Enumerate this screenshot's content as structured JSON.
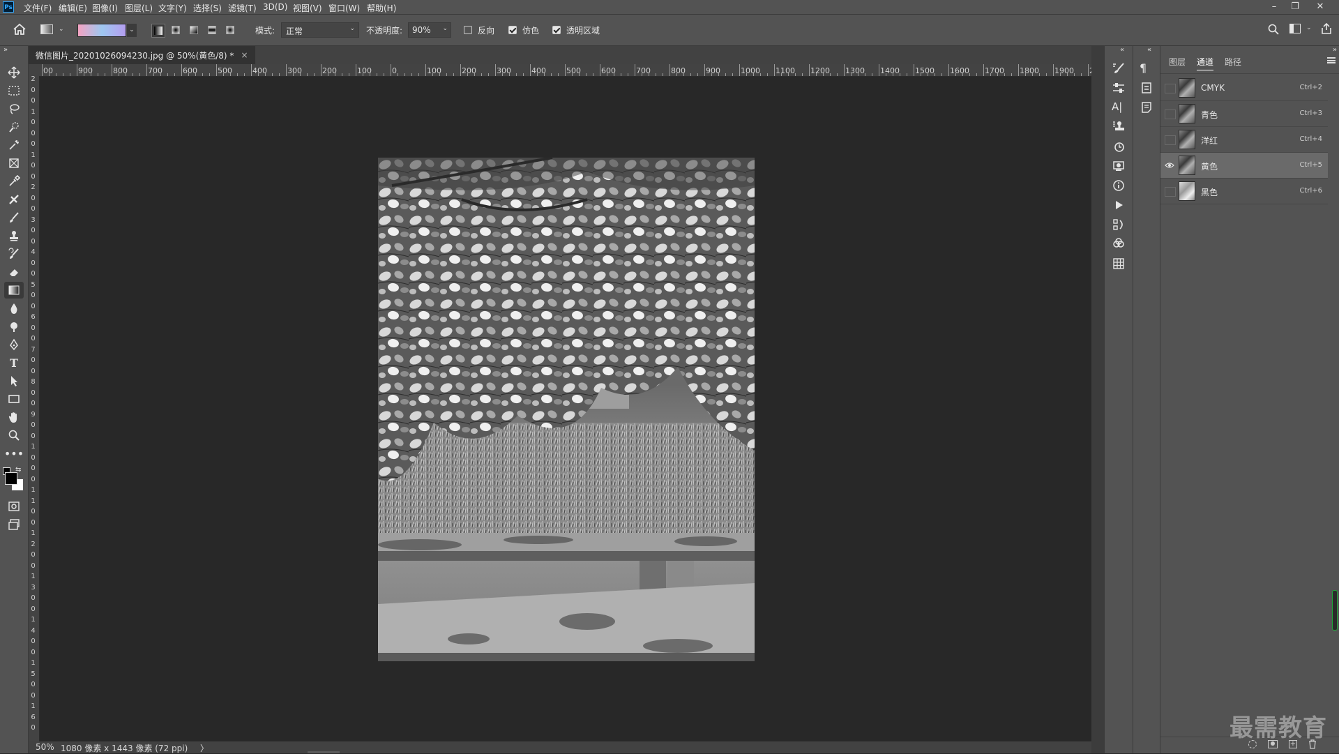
{
  "app": "Ps",
  "menu": [
    "文件(F)",
    "编辑(E)",
    "图像(I)",
    "图层(L)",
    "文字(Y)",
    "选择(S)",
    "滤镜(T)",
    "3D(D)",
    "视图(V)",
    "窗口(W)",
    "帮助(H)"
  ],
  "window_controls": [
    "minimize",
    "restore",
    "close"
  ],
  "options": {
    "mode_label": "模式:",
    "mode_value": "正常",
    "opacity_label": "不透明度:",
    "opacity_value": "90%",
    "reverse_label": "反向",
    "dither_label": "仿色",
    "transparency_label": "透明区域",
    "reverse_checked": false,
    "dither_checked": true,
    "transparency_checked": true
  },
  "document": {
    "tab_title": "微信图片_20201026094230.jpg @ 50%(黄色/8) *",
    "close": "×"
  },
  "ruler_h": [
    "00",
    "900",
    "800",
    "700",
    "600",
    "500",
    "400",
    "300",
    "200",
    "100",
    "0",
    "100",
    "200",
    "300",
    "400",
    "500",
    "600",
    "700",
    "800",
    "900",
    "1000",
    "1100",
    "1200",
    "1300",
    "1400",
    "1500",
    "1600",
    "1700",
    "1800",
    "1900",
    "200"
  ],
  "ruler_v": [
    "2",
    "0",
    "0",
    "1",
    "0",
    "0",
    "0",
    "1",
    "0",
    "0",
    "2",
    "0",
    "0",
    "3",
    "0",
    "0",
    "4",
    "0",
    "0",
    "5",
    "0",
    "0",
    "6",
    "0",
    "0",
    "7",
    "0",
    "0",
    "8",
    "0",
    "0",
    "9",
    "0",
    "0",
    "1",
    "0",
    "0",
    "0",
    "1",
    "1",
    "0",
    "0",
    "1",
    "2",
    "0",
    "0",
    "1",
    "3",
    "0",
    "0",
    "1",
    "4",
    "0",
    "0",
    "1",
    "5",
    "0",
    "0",
    "1",
    "6",
    "0"
  ],
  "status": {
    "zoom": "50%",
    "info": "1080 像素 x 1443 像素 (72 ppi)",
    "arrow": "〉"
  },
  "panel": {
    "tabs": [
      "图层",
      "通道",
      "路径"
    ],
    "active_tab": "通道",
    "channels": [
      {
        "name": "CMYK",
        "shortcut": "Ctrl+2",
        "visible": false,
        "selected": false
      },
      {
        "name": "青色",
        "shortcut": "Ctrl+3",
        "visible": false,
        "selected": false
      },
      {
        "name": "洋红",
        "shortcut": "Ctrl+4",
        "visible": false,
        "selected": false
      },
      {
        "name": "黄色",
        "shortcut": "Ctrl+5",
        "visible": true,
        "selected": true
      },
      {
        "name": "黑色",
        "shortcut": "Ctrl+6",
        "visible": false,
        "selected": false
      }
    ]
  },
  "watermark": "最需教育",
  "colors": {
    "ui_dark": "#535353",
    "canvas_bg": "#282828",
    "ps_blue": "#31a8ff"
  }
}
